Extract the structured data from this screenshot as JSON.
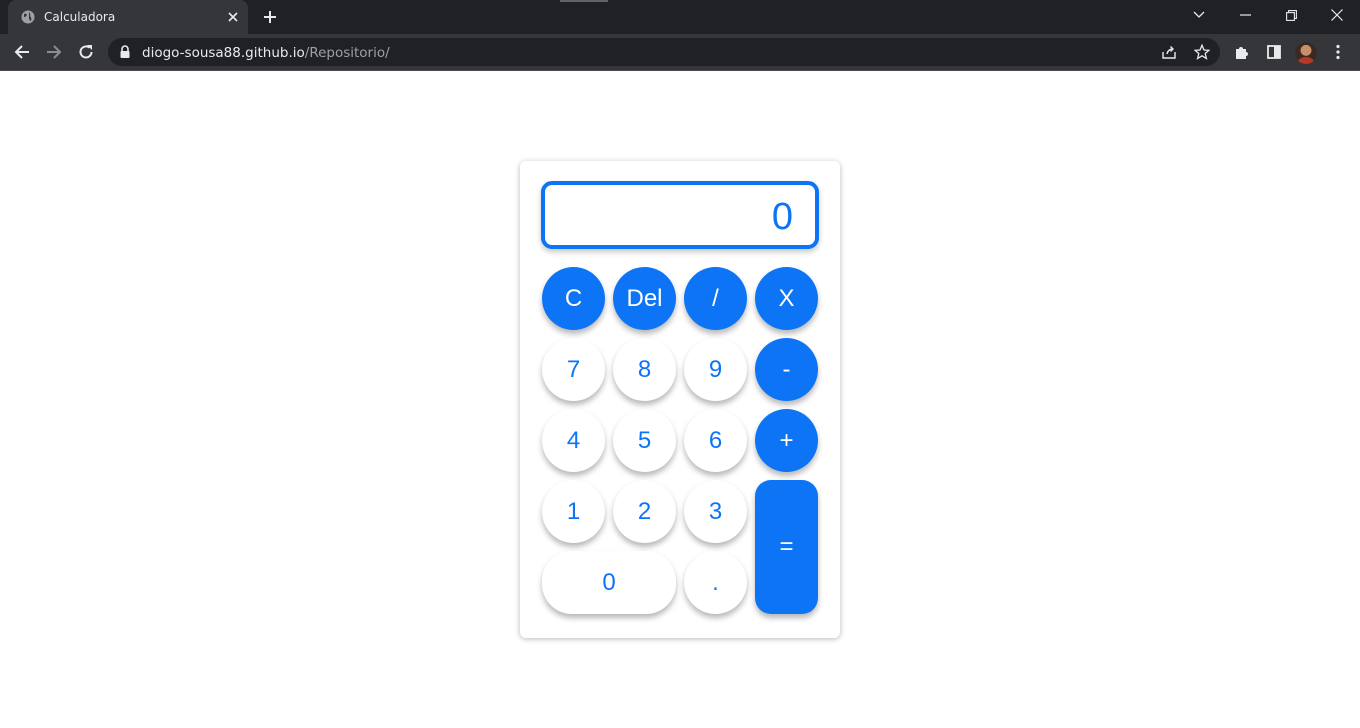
{
  "browser": {
    "tab_title": "Calculadora",
    "url_host": "diogo-sousa88.github.io",
    "url_path": "/Repositorio/",
    "icons": [
      "globe-icon",
      "close-icon",
      "plus-icon",
      "chevron-down-icon",
      "minimize-icon",
      "restore-icon",
      "back-icon",
      "forward-icon",
      "reload-icon",
      "lock-icon",
      "share-icon",
      "star-icon",
      "extensions-icon",
      "sidepanel-icon",
      "avatar",
      "menu-icon"
    ]
  },
  "calculator": {
    "display": "0",
    "accent": "#0d75f5",
    "keys": {
      "clear": "C",
      "delete": "Del",
      "divide": "/",
      "multiply": "X",
      "seven": "7",
      "eight": "8",
      "nine": "9",
      "minus": "-",
      "four": "4",
      "five": "5",
      "six": "6",
      "plus": "+",
      "one": "1",
      "two": "2",
      "three": "3",
      "equals": "=",
      "zero": "0",
      "decimal": "."
    }
  }
}
